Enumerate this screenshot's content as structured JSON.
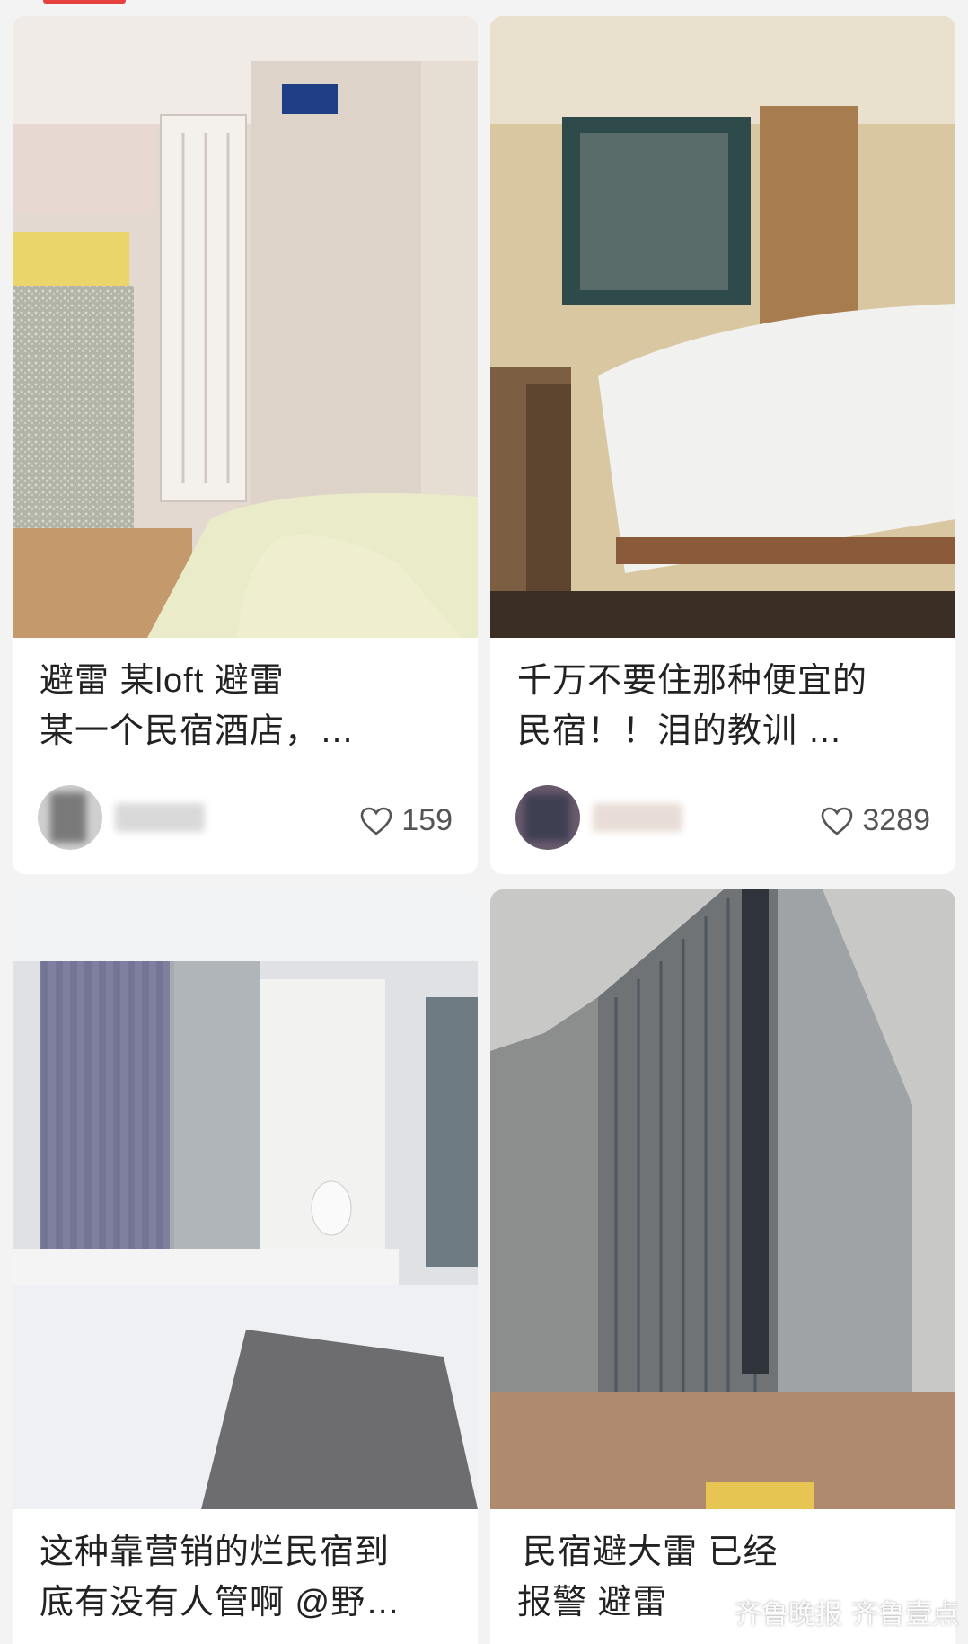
{
  "app": {
    "accent_color": "#e8403d"
  },
  "feed": {
    "cards": [
      {
        "title_line1": "避雷 某loft 避雷",
        "title_line2": "某一个民宿酒店，…",
        "likes": "159",
        "heart_icon": "heart-outline-icon"
      },
      {
        "title_line1": "千万不要住那种便宜的",
        "title_line2": "民宿！！泪的教训 …",
        "likes": "3289",
        "heart_icon": "heart-outline-icon"
      },
      {
        "title_line1": "这种靠营销的烂民宿到",
        "title_line2": "底有没有人管啊 @野…"
      },
      {
        "title_line1": "民宿避大雷 已经",
        "title_line2": "报警 避雷"
      }
    ]
  },
  "watermark": {
    "left_text": "齐鲁晚报",
    "right_text": "齐鲁壹点"
  }
}
